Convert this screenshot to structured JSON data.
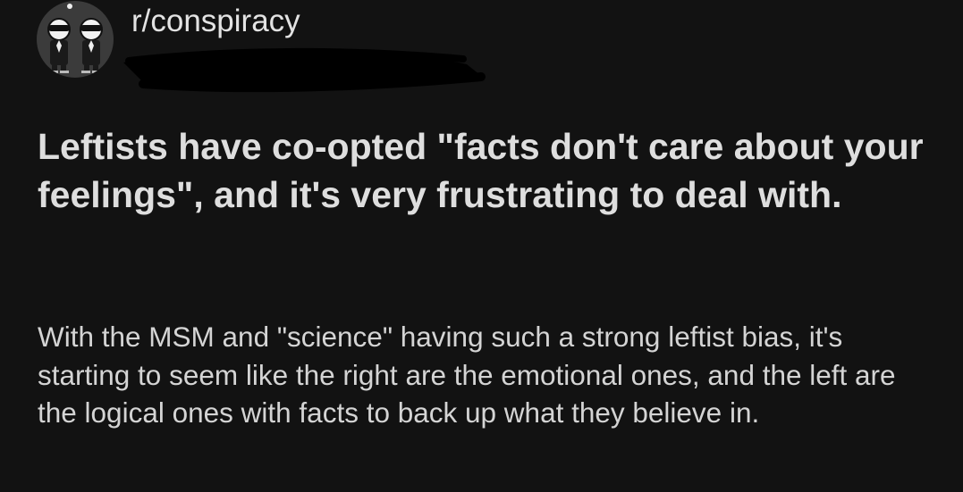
{
  "subreddit": {
    "name": "r/conspiracy",
    "avatar_icon": "twin-agents-icon"
  },
  "post": {
    "title": "Leftists have co-opted \"facts don't care about your feelings\", and it's very frustrating to deal with.",
    "body": "With the MSM and \"science\" having such a strong leftist bias, it's starting to seem like the right are the emotional ones, and the left are the logical ones with facts to back up what they believe in."
  },
  "colors": {
    "background": "#121212",
    "text": "#d9d9d9",
    "avatar_bg": "#3b3b3b",
    "redaction": "#000000"
  }
}
